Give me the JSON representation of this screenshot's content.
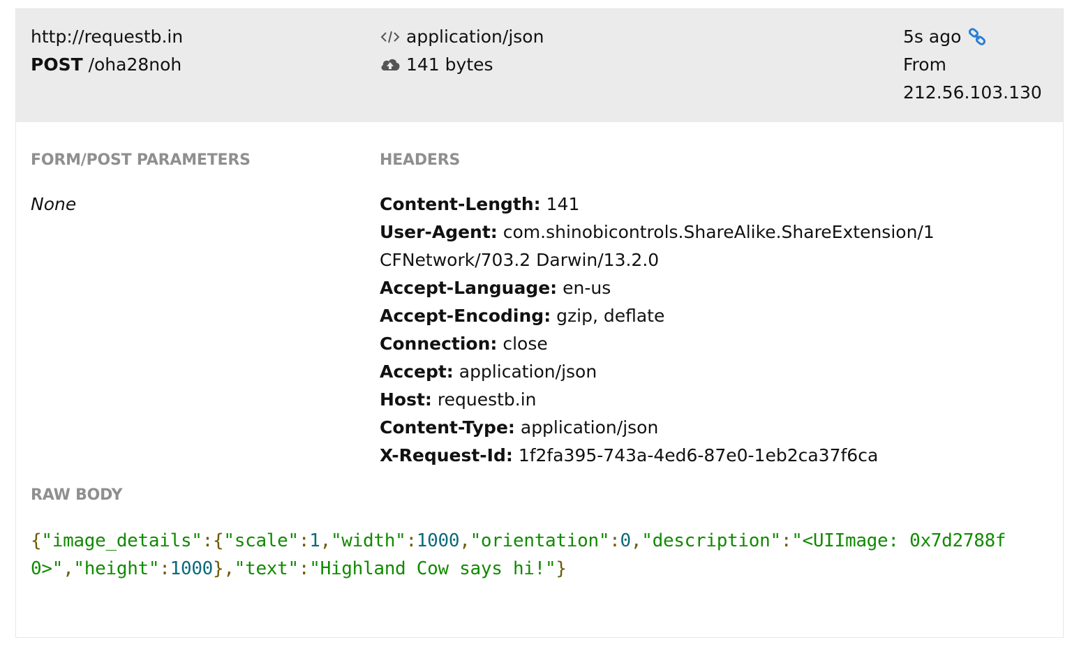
{
  "request": {
    "host": "http://requestb.in",
    "method": "POST",
    "path": "/oha28noh",
    "content_type": "application/json",
    "size": "141 bytes",
    "age": "5s ago",
    "from_label": "From",
    "from_ip": "212.56.103.130"
  },
  "icons": {
    "code": "code-icon",
    "upload": "cloud-upload-icon",
    "link": "link-icon"
  },
  "sections": {
    "form": "FORM/POST PARAMETERS",
    "headers": "HEADERS",
    "raw": "RAW BODY"
  },
  "form_params_value": "None",
  "headers": [
    {
      "name": "Content-Length:",
      "value": " 141"
    },
    {
      "name": "User-Agent:",
      "value": " com.shinobicontrols.ShareAlike.ShareExtension/1",
      "cont": "CFNetwork/703.2 Darwin/13.2.0"
    },
    {
      "name": "Accept-Language:",
      "value": " en-us"
    },
    {
      "name": "Accept-Encoding:",
      "value": " gzip, deflate"
    },
    {
      "name": "Connection:",
      "value": " close"
    },
    {
      "name": "Accept:",
      "value": " application/json"
    },
    {
      "name": "Host:",
      "value": " requestb.in"
    },
    {
      "name": "Content-Type:",
      "value": " application/json"
    },
    {
      "name": "X-Request-Id:",
      "value": " 1f2fa395-743a-4ed6-87e0-1eb2ca37f6ca"
    }
  ],
  "raw_body": {
    "line1": [
      {
        "t": "{",
        "k": "punc"
      },
      {
        "t": "\"image_details\"",
        "k": "str"
      },
      {
        "t": ":{",
        "k": "punc"
      },
      {
        "t": "\"scale\"",
        "k": "str"
      },
      {
        "t": ":",
        "k": "punc"
      },
      {
        "t": "1",
        "k": "num"
      },
      {
        "t": ",",
        "k": "punc"
      },
      {
        "t": "\"width\"",
        "k": "str"
      },
      {
        "t": ":",
        "k": "punc"
      },
      {
        "t": "1000",
        "k": "num"
      },
      {
        "t": ",",
        "k": "punc"
      },
      {
        "t": "\"orientation\"",
        "k": "str"
      },
      {
        "t": ":",
        "k": "punc"
      },
      {
        "t": "0",
        "k": "num"
      },
      {
        "t": ",",
        "k": "punc"
      },
      {
        "t": "\"description\"",
        "k": "str"
      },
      {
        "t": ":",
        "k": "punc"
      },
      {
        "t": "\"<UIImage: 0x7d2788f",
        "k": "str"
      }
    ],
    "line2": [
      {
        "t": "0>\"",
        "k": "str"
      },
      {
        "t": ",",
        "k": "punc"
      },
      {
        "t": "\"height\"",
        "k": "str"
      },
      {
        "t": ":",
        "k": "punc"
      },
      {
        "t": "1000",
        "k": "num"
      },
      {
        "t": "},",
        "k": "punc"
      },
      {
        "t": "\"text\"",
        "k": "str"
      },
      {
        "t": ":",
        "k": "punc"
      },
      {
        "t": "\"Highland Cow says hi!\"",
        "k": "str"
      },
      {
        "t": "}",
        "k": "punc"
      }
    ]
  },
  "colors": {
    "top_bg": "#ebebeb",
    "section_title": "#8f8f8f",
    "json_string": "#118a00",
    "json_number": "#0b6a7a",
    "json_punct": "#6e5a00",
    "link": "#2a7fd4"
  }
}
